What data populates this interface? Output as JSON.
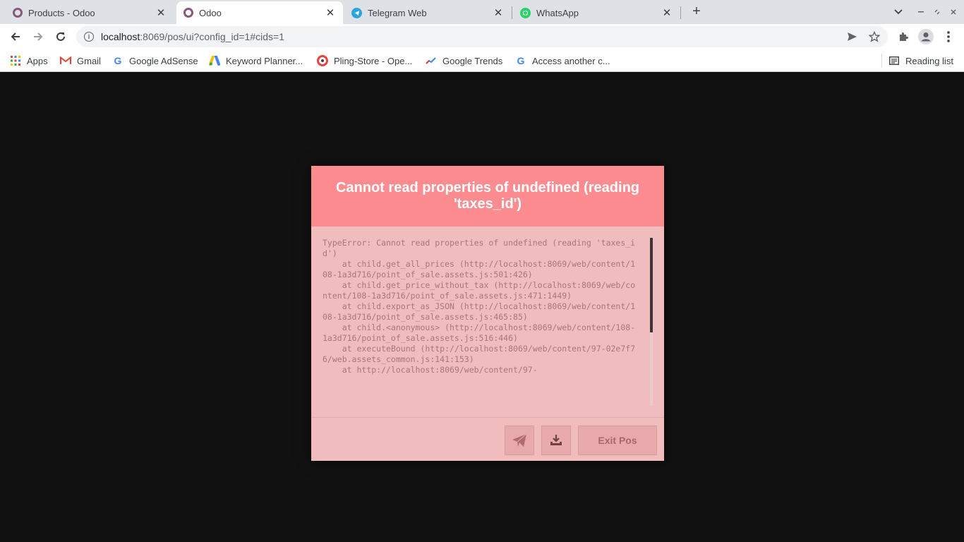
{
  "tabs": [
    {
      "title": "Products - Odoo",
      "favicon": "odoo-icon",
      "active": false
    },
    {
      "title": "Odoo",
      "favicon": "odoo-icon",
      "active": true
    },
    {
      "title": "Telegram Web",
      "favicon": "telegram-icon",
      "active": false
    },
    {
      "title": "WhatsApp",
      "favicon": "whatsapp-icon",
      "active": false
    }
  ],
  "address_bar": {
    "host": "localhost",
    "rest": ":8069/pos/ui?config_id=1#cids=1"
  },
  "bookmarks": [
    {
      "label": "Apps",
      "icon": "apps-grid-icon"
    },
    {
      "label": "Gmail",
      "icon": "gmail-icon"
    },
    {
      "label": "Google AdSense",
      "icon": "google-icon"
    },
    {
      "label": "Keyword Planner...",
      "icon": "google-ads-icon"
    },
    {
      "label": "Pling-Store - Ope...",
      "icon": "pling-icon"
    },
    {
      "label": "Google Trends",
      "icon": "trends-icon"
    },
    {
      "label": "Access another c...",
      "icon": "google-icon"
    }
  ],
  "reading_list": "Reading list",
  "dialog": {
    "title": "Cannot read properties of undefined (reading 'taxes_id')",
    "traceback": "TypeError: Cannot read properties of undefined (reading 'taxes_id')\n    at child.get_all_prices (http://localhost:8069/web/content/108-1a3d716/point_of_sale.assets.js:501:426)\n    at child.get_price_without_tax (http://localhost:8069/web/content/108-1a3d716/point_of_sale.assets.js:471:1449)\n    at child.export_as_JSON (http://localhost:8069/web/content/108-1a3d716/point_of_sale.assets.js:465:85)\n    at child.<anonymous> (http://localhost:8069/web/content/108-1a3d716/point_of_sale.assets.js:516:446)\n    at executeBound (http://localhost:8069/web/content/97-02e7f76/web.assets_common.js:141:153)\n    at http://localhost:8069/web/content/97-",
    "exit_label": "Exit Pos"
  },
  "colors": {
    "dialog_header": "#fc8c8f",
    "dialog_body": "#f0bcbe",
    "page_background": "#121112"
  }
}
